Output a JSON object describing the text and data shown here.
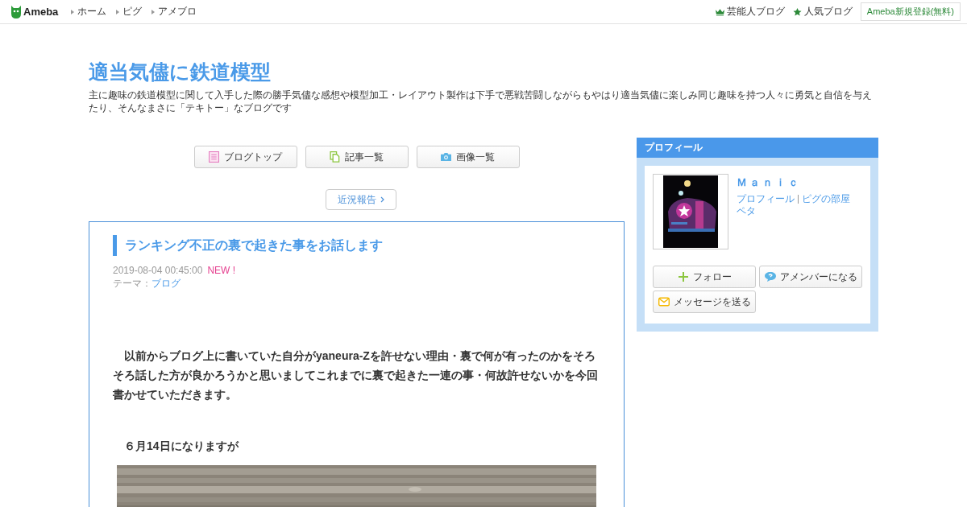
{
  "header": {
    "logo": "Ameba",
    "nav": [
      "ホーム",
      "ピグ",
      "アメブロ"
    ],
    "links": [
      {
        "kind": "crown",
        "label": "芸能人ブログ"
      },
      {
        "kind": "star",
        "label": "人気ブログ"
      }
    ],
    "signup": "Ameba新規登録(無料)"
  },
  "blog": {
    "title": "適当気儘に鉄道模型",
    "description": "主に趣味の鉄道模型に関して入手した際の勝手気儘な感想や模型加工・レイアウト製作は下手で悪戦苦闘しながらもやはり適当気儘に楽しみ同じ趣味を持つ人々に勇気と自信を与えたり、そんなまさに「テキトー」なブログです"
  },
  "menu": [
    {
      "kind": "list",
      "label": "ブログトップ"
    },
    {
      "kind": "doc",
      "label": "記事一覧"
    },
    {
      "kind": "camera",
      "label": "画像一覧"
    }
  ],
  "recent": "近況報告",
  "article": {
    "title": "ランキング不正の裏で起きた事をお話します",
    "date": "2019-08-04 00:45:00",
    "badge": "NEW !",
    "theme_label": "テーマ：",
    "theme": "ブログ",
    "paragraphs": [
      "　以前からブログ上に書いていた自分がyaneura-Zを許せない理由・裏で何が有ったのかをそろそろ話した方が良かろうかと思いましてこれまでに裏で起きた一連の事・何故許せないかを今回書かせていただきます。",
      "　６月14日になりますが"
    ],
    "image": {
      "kind": "picture"
    }
  },
  "profile": {
    "heading": "プロフィール",
    "name": "Ｍａｎｉｃ",
    "links": [
      "プロフィール",
      "ピグの部屋"
    ],
    "peta": "ペタ",
    "buttons": [
      {
        "kind": "plus",
        "label": "フォロー"
      },
      {
        "kind": "bubble",
        "label": "アメンバーになる"
      },
      {
        "kind": "mail",
        "label": "メッセージを送る"
      }
    ]
  }
}
